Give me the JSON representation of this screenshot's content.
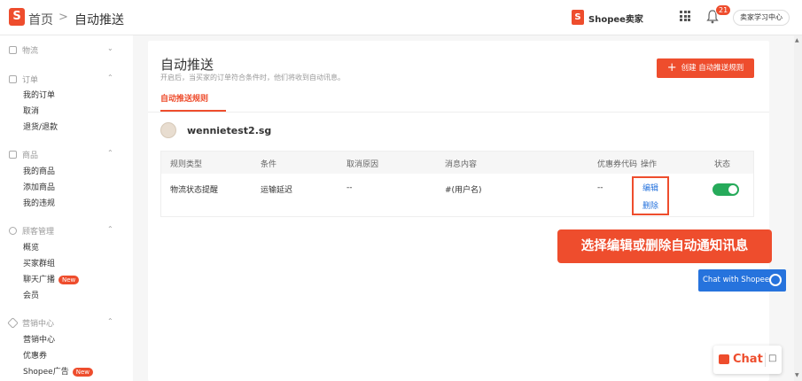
{
  "header": {
    "breadcrumb_home": "首页",
    "breadcrumb_sep": ">",
    "breadcrumb_current": "自动推送",
    "shopee_brand": "Shopee卖家",
    "notif_count": "21",
    "learn_center": "卖家学习中心"
  },
  "sidebar": {
    "logistics": "物流",
    "orders": "订单",
    "order_items": [
      "我的订单",
      "取消",
      "退货/退款"
    ],
    "products": "商品",
    "product_items": [
      "我的商品",
      "添加商品",
      "我的违规"
    ],
    "customers": "顾客管理",
    "customer_items": [
      "概览",
      "买家群组",
      "聊天广播",
      "会员"
    ],
    "marketing": "营销中心",
    "marketing_items": [
      "营销中心",
      "优惠券",
      "Shopee广告"
    ],
    "new_badge": "New"
  },
  "main": {
    "title": "自动推送",
    "subtitle": "开启后，当买家的订单符合条件时，他们将收到自动讯息。",
    "create_button": "创建 自动推送规则",
    "tab_label": "自动推送规则",
    "shop_name": "wennietest2.sg",
    "table": {
      "headers": [
        "规则类型",
        "条件",
        "取消原因",
        "消息内容",
        "优惠券代码",
        "操作",
        "状态"
      ],
      "row": {
        "rule_type": "物流状态提醒",
        "condition": "运输延迟",
        "cancel_reason": "--",
        "message": "#(用户名)",
        "voucher": "--",
        "edit": "编辑",
        "delete": "删除",
        "status_on": true
      }
    }
  },
  "callout": "选择编辑或删除自动通知讯息",
  "chat_with_shopee": "Chat with Shopee",
  "chat_label": "Chat",
  "colors": {
    "brand": "#ee4d2d",
    "link": "#2673dd",
    "toggle_on": "#26aa5a"
  }
}
